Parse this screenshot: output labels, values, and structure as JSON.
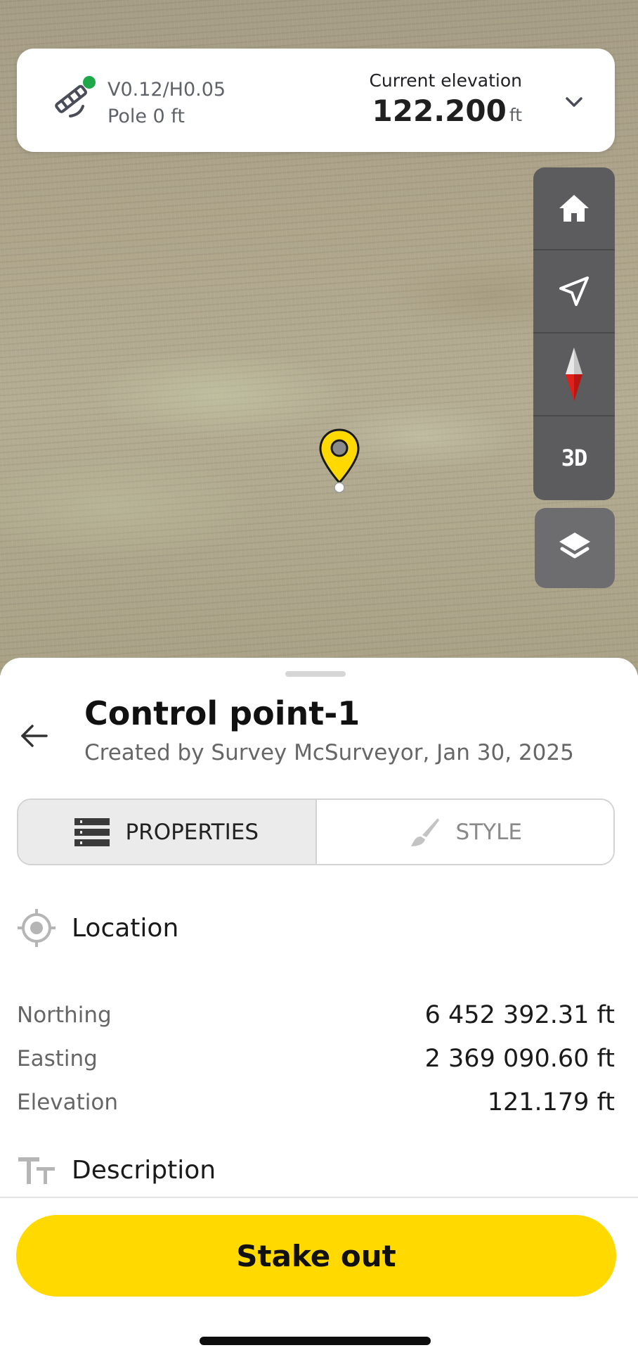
{
  "status_card": {
    "accuracy": "V0.12/H0.05",
    "pole": "Pole 0 ft",
    "elevation_label": "Current elevation",
    "elevation_value": "122.200",
    "elevation_unit": "ft",
    "gnss_status_color": "#1fa84a"
  },
  "map_controls": {
    "home_icon": "home-icon",
    "locate_icon": "navigation-arrow-icon",
    "compass_icon": "compass-icon",
    "view_3d_label": "3D",
    "layers_icon": "layers-icon",
    "pin_color": "#ffd900"
  },
  "point": {
    "title": "Control point-1",
    "created_by": "Created by Survey McSurveyor, Jan 30, 2025"
  },
  "tabs": [
    {
      "label": "PROPERTIES",
      "icon": "list-icon",
      "active": true
    },
    {
      "label": "STYLE",
      "icon": "brush-icon",
      "active": false
    }
  ],
  "location": {
    "heading": "Location",
    "rows": [
      {
        "label": "Northing",
        "value": "6 452 392.31 ft"
      },
      {
        "label": "Easting",
        "value": "2 369 090.60 ft"
      },
      {
        "label": "Elevation",
        "value": "121.179 ft"
      }
    ]
  },
  "description": {
    "heading": "Description"
  },
  "actions": {
    "stake_out_label": "Stake out",
    "accent_color": "#ffd900"
  }
}
